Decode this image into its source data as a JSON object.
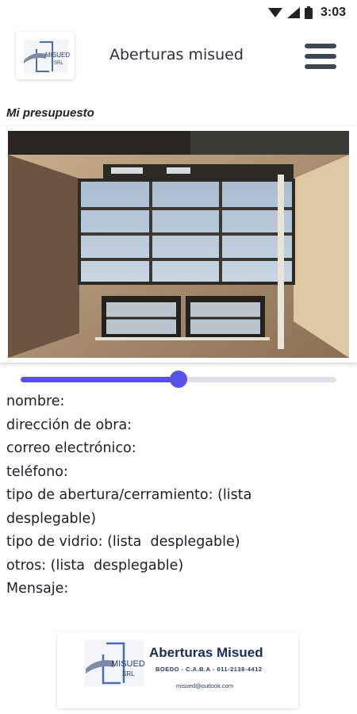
{
  "status_bar": {
    "time": "3:03",
    "icons": [
      "wifi-icon",
      "signal-icon",
      "battery-icon"
    ]
  },
  "header": {
    "logo_text": "MISUED",
    "logo_sub": "SRL",
    "title": "Aberturas misued",
    "menu_icon": "hamburger-menu-icon"
  },
  "section_title": "Mi presupuesto",
  "slider": {
    "value": 0.5
  },
  "form_lines": [
    "nombre:",
    "dirección de obra:",
    "correo electrónico:",
    "teléfono:",
    "tipo de abertura/cerramiento: (lista desplegable)",
    "tipo de vidrio: (lista  desplegable)",
    "otros: (lista  desplegable)",
    "Mensaje:"
  ],
  "footer": {
    "logo_text": "MISUED",
    "logo_sub": "SRL",
    "brand": "Aberturas Misued",
    "address": "BOEDO - C.A.B.A - 011-2138-4412",
    "email": "misued@outlook.com"
  },
  "colors": {
    "accent": "#5a52e8",
    "track": "#dfe1ea",
    "menu": "#3e4653",
    "brand": "#1c2c55"
  }
}
